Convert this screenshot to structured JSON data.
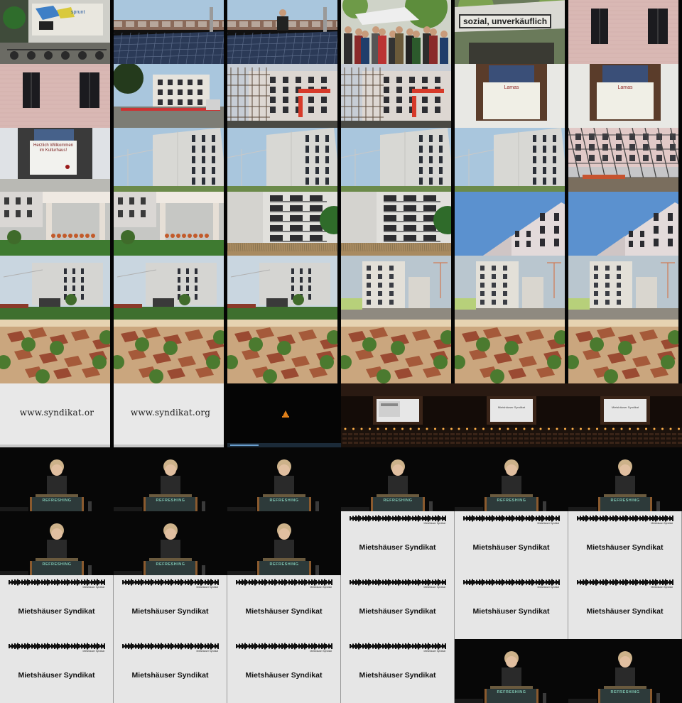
{
  "sheet": {
    "columns": 6,
    "rows": 11
  },
  "frames": [
    {
      "scene": "graffiti-wall",
      "text": "sprunt"
    },
    {
      "scene": "solar-roof"
    },
    {
      "scene": "solar-roof-worker"
    },
    {
      "scene": "crowd-market"
    },
    {
      "scene": "banner-umbrella",
      "text": "sozial, unverkäuflich"
    },
    {
      "scene": "pink-facade-windows"
    },
    {
      "scene": "pink-facade-windows"
    },
    {
      "scene": "construction-building"
    },
    {
      "scene": "scaffold-building"
    },
    {
      "scene": "scaffold-building"
    },
    {
      "scene": "window-placard",
      "text": "Lamas"
    },
    {
      "scene": "window-placard",
      "text": "Lamas"
    },
    {
      "scene": "window-placard-wide"
    },
    {
      "scene": "white-block-crane"
    },
    {
      "scene": "white-block-crane"
    },
    {
      "scene": "white-block-crane"
    },
    {
      "scene": "white-block-crane"
    },
    {
      "scene": "pink-building-scaffold"
    },
    {
      "scene": "garden-porch"
    },
    {
      "scene": "garden-porch"
    },
    {
      "scene": "balcony-building"
    },
    {
      "scene": "balcony-building"
    },
    {
      "scene": "corner-sky"
    },
    {
      "scene": "corner-sky"
    },
    {
      "scene": "white-block-grass"
    },
    {
      "scene": "white-block-grass"
    },
    {
      "scene": "white-block-grass"
    },
    {
      "scene": "street-building"
    },
    {
      "scene": "street-building"
    },
    {
      "scene": "street-building"
    },
    {
      "scene": "aerial-town"
    },
    {
      "scene": "aerial-town"
    },
    {
      "scene": "aerial-town"
    },
    {
      "scene": "aerial-town"
    },
    {
      "scene": "aerial-town"
    },
    {
      "scene": "aerial-town"
    },
    {
      "scene": "url-slide",
      "text": "www.syndikat.or"
    },
    {
      "scene": "url-slide",
      "text": "www.syndikat.org"
    },
    {
      "scene": "dark-player"
    },
    {
      "scene": "hall-stage"
    },
    {
      "scene": "hall-stage",
      "text": "Mietshäuser Syndikat"
    },
    {
      "scene": "hall-stage",
      "text": "Mietshäuser Syndikat"
    },
    {
      "scene": "speaker"
    },
    {
      "scene": "speaker"
    },
    {
      "scene": "speaker"
    },
    {
      "scene": "speaker"
    },
    {
      "scene": "speaker"
    },
    {
      "scene": "speaker"
    },
    {
      "scene": "speaker"
    },
    {
      "scene": "speaker"
    },
    {
      "scene": "speaker"
    },
    {
      "scene": "slide",
      "text": "Mietshäuser Syndikat"
    },
    {
      "scene": "slide",
      "text": "Mietshäuser Syndikat"
    },
    {
      "scene": "slide",
      "text": "Mietshäuser Syndikat"
    },
    {
      "scene": "slide",
      "text": "Mietshäuser Syndikat"
    },
    {
      "scene": "slide",
      "text": "Mietshäuser Syndikat"
    },
    {
      "scene": "slide",
      "text": "Mietshäuser Syndikat"
    },
    {
      "scene": "slide",
      "text": "Mietshäuser Syndikat"
    },
    {
      "scene": "slide",
      "text": "Mietshäuser Syndikat"
    },
    {
      "scene": "slide",
      "text": "Mietshäuser Syndikat"
    },
    {
      "scene": "slide",
      "text": "Mietshäuser Syndikat"
    },
    {
      "scene": "slide",
      "text": "Mietshäuser Syndikat"
    },
    {
      "scene": "slide",
      "text": "Mietshäuser Syndikat"
    },
    {
      "scene": "slide",
      "text": "Mietshäuser Syndikat"
    },
    {
      "scene": "speaker"
    },
    {
      "scene": "speaker"
    }
  ],
  "podium_logo": "REFRESHING",
  "slide_small_text": "Mietshäuser Syndikat",
  "placard_text": "Herzlich Willkommen im Kulturhaus!",
  "colors": {
    "sky": "#a9c6dd",
    "pink_facade": "#d9b8b4",
    "white_building": "#d8d8d4",
    "slide_bg": "#e6e6e6",
    "stage_dark": "#070707",
    "roof_tile": "#a55a3a",
    "tree_green": "#4b7a2f"
  }
}
